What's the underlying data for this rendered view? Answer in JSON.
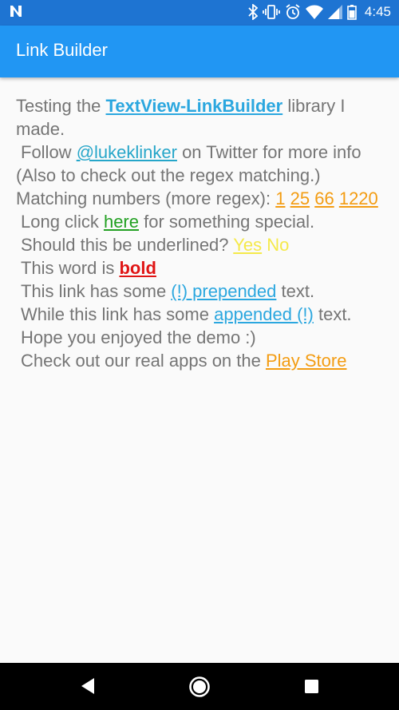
{
  "status_bar": {
    "time": "4:45",
    "icons": [
      "n-icon",
      "bluetooth-icon",
      "vibrate-icon",
      "alarm-icon",
      "wifi-icon",
      "signal-icon",
      "battery-icon"
    ]
  },
  "app_bar": {
    "title": "Link Builder"
  },
  "colors": {
    "app_bar": "#2196f3",
    "status_bar": "#1e74d2",
    "body_text": "#757575",
    "link_blue": "#2ba7df",
    "link_orange": "#f39c12",
    "link_green": "#22a022",
    "link_yellow": "#f5e94a",
    "link_red": "#e01515"
  },
  "content": {
    "p1": {
      "before": "Testing the ",
      "link": "TextView-LinkBuilder",
      "after": " library I made."
    },
    "p2": {
      "before": " Follow ",
      "link": "@lukeklinker",
      "after": " on Twitter for more info (Also to check out the regex matching.)"
    },
    "p3": {
      "before": " Matching numbers (more regex): ",
      "n1": "1",
      "n2": "25",
      "n3": "66",
      "n4": "1220"
    },
    "p4": {
      "before": "Long click ",
      "link": "here",
      "after": " for something special."
    },
    "p5": {
      "before": "Should this be underlined? ",
      "yes": "Yes",
      "no": "No"
    },
    "p6": {
      "before": "This word is ",
      "link": "bold"
    },
    "p7": {
      "before": "This link has some ",
      "link": "(!) prepended",
      "after": " text."
    },
    "p8": {
      "before": "While this link has some ",
      "link": "appended (!)",
      "after": " text."
    },
    "p9": {
      "text": "Hope you enjoyed the demo :)"
    },
    "p10": {
      "before": "Check out our real apps on the ",
      "link": "Play Store"
    }
  },
  "nav_bar": {
    "icons": [
      "back-icon",
      "home-icon",
      "recents-icon"
    ]
  }
}
